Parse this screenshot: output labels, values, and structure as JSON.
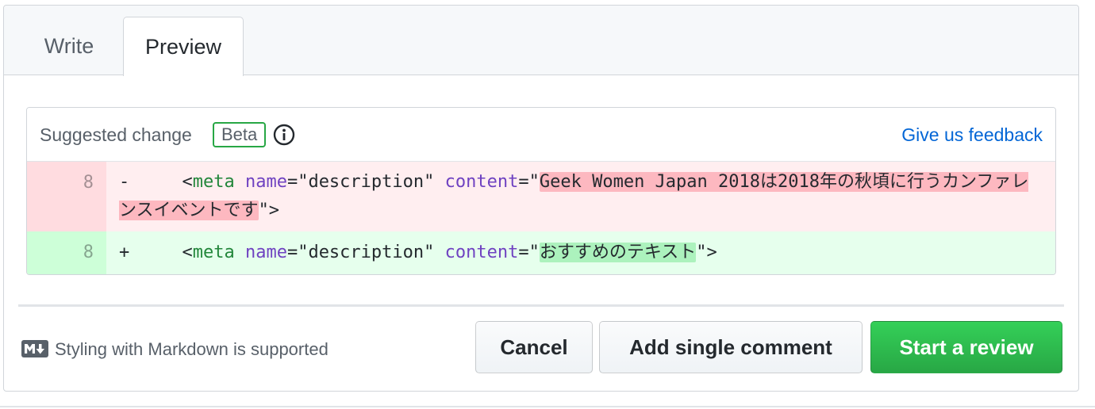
{
  "tabs": {
    "write": "Write",
    "preview": "Preview"
  },
  "suggestion": {
    "title": "Suggested change",
    "badge": "Beta",
    "feedback_link": "Give us feedback",
    "icon": "info-icon"
  },
  "diff": {
    "deleted": {
      "line_number": "8",
      "sign": "-",
      "indent": "     ",
      "tag_open": "<",
      "tag_name": "meta",
      "attr1": "name",
      "attr1_value": "=\"description\" ",
      "attr2": "content",
      "eq_quote": "=\"",
      "text": "Geek Women Japan 2018は2018年の秋頃に行うカンファレンスイベントです",
      "close": "\">"
    },
    "added": {
      "line_number": "8",
      "sign": "+",
      "indent": "     ",
      "tag_open": "<",
      "tag_name": "meta",
      "attr1": "name",
      "attr1_value": "=\"description\" ",
      "attr2": "content",
      "eq_quote": "=\"",
      "text": "おすすめのテキスト",
      "close": "\">"
    }
  },
  "footer": {
    "markdown_note": "Styling with Markdown is supported",
    "markdown_icon": "markdown-icon",
    "cancel": "Cancel",
    "add_single": "Add single comment",
    "start_review": "Start a review"
  },
  "colors": {
    "primary_green": "#2cbe4e",
    "link_blue": "#0366d6",
    "deletion_bg": "#ffeef0",
    "addition_bg": "#e6ffed"
  }
}
